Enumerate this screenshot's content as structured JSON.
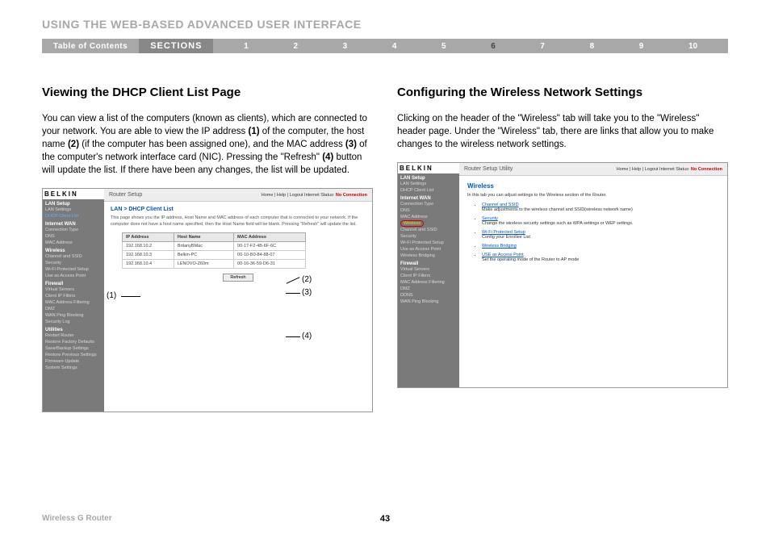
{
  "header": {
    "title": "USING THE WEB-BASED ADVANCED USER INTERFACE"
  },
  "nav": {
    "toc": "Table of Contents",
    "sections": "SECTIONS",
    "nums": [
      "1",
      "2",
      "3",
      "4",
      "5",
      "6",
      "7",
      "8",
      "9",
      "10"
    ],
    "active": "6"
  },
  "left": {
    "heading": "Viewing the DHCP Client List Page",
    "para": "You can view a list of the computers (known as clients), which are connected to your network. You are able to view the IP address (1) of the computer, the host name (2) (if the computer has been assigned one), and the MAC address (3) of the computer's network interface card (NIC). Pressing the \"Refresh\" (4) button will update the list. If there have been any changes, the list will be updated.",
    "ss": {
      "brand": "BELKIN",
      "setup": "Router Setup",
      "toplinks": "Home | Help | Logout   Internet Status:",
      "noconn": "No Connection",
      "crumb": "LAN > DHCP Client List",
      "desc": "This page shows you the IP address, Host Name and MAC address of each computer that is connected to your network. If the computer does not have a host name specified, then the Host Name field will be blank. Pressing \"Refresh\" will update the list.",
      "th": [
        "IP Address",
        "Host Name",
        "MAC Address"
      ],
      "rows": [
        [
          "192.168.10.2",
          "BritanyBMac",
          "00-17-F2-4B-6F-6C"
        ],
        [
          "192.168.10.3",
          "Belkin-PC",
          "00-10-B0-84-88-07"
        ],
        [
          "192.168.10.4",
          "LENOVO-Z60m",
          "00-16-36-59-D6-31"
        ]
      ],
      "refresh": "Refresh",
      "side": {
        "g1": "LAN Setup",
        "g1a": "LAN Settings",
        "g1b": "DHCP Client List",
        "g2": "Internet WAN",
        "g2a": "Connection Type",
        "g2b": "DNS",
        "g2c": "MAC Address",
        "g3": "Wireless",
        "g3a": "Channel and SSID",
        "g3b": "Security",
        "g3c": "Wi-Fi Protected Setup",
        "g3d": "Use as Access Point",
        "g4": "Firewall",
        "g4a": "Virtual Servers",
        "g4b": "Client IP Filters",
        "g4c": "MAC Address Filtering",
        "g4d": "DMZ",
        "g4e": "WAN Ping Blocking",
        "g4f": "Security Log",
        "g5": "Utilities",
        "g5a": "Restart Router",
        "g5b": "Restore Factory Defaults",
        "g5c": "Save/Backup Settings",
        "g5d": "Restore Previous Settings",
        "g5e": "Firmware Update",
        "g5f": "System Settings"
      }
    },
    "annots": {
      "a1": "(1)",
      "a2": "(2)",
      "a3": "(3)",
      "a4": "(4)"
    }
  },
  "right": {
    "heading": "Configuring the Wireless Network Settings",
    "para": "Clicking on the header of the \"Wireless\" tab will take you to the \"Wireless\" header page. Under the \"Wireless\" tab, there are links that allow you to make changes to the wireless network settings.",
    "ss": {
      "brand": "BELKIN",
      "setup": "Router Setup Utility",
      "toplinks": "Home | Help | Logout   Internet Status:",
      "noconn": "No Connection",
      "whead": "Wireless",
      "wdesc": "In this tab you can adjust settings to the Wireless section of the Router.",
      "items": [
        {
          "t": "Channel and SSID",
          "d": "Make adjustments to the wireless channel and SSID(wireless network name)"
        },
        {
          "t": "Security",
          "d": "Change the wireless security settings such as WPA settings or WEP settings."
        },
        {
          "t": "Wi-Fi Protected Setup",
          "d": "Config your Enrollee List"
        },
        {
          "t": "Wireless Bridging",
          "d": ""
        },
        {
          "t": "USE as Access Point",
          "d": "Set the operating mode of the Router to AP mode"
        }
      ],
      "side": {
        "g1": "LAN Setup",
        "g1a": "LAN Settings",
        "g1b": "DHCP Client List",
        "g2": "Internet WAN",
        "g2a": "Connection Type",
        "g2b": "DNS",
        "g2c": "MAC Address",
        "g3": "Wireless",
        "g3a": "Channel and SSID",
        "g3b": "Security",
        "g3c": "Wi-Fi Protected Setup",
        "g3d": "Use as Access Point",
        "g3e": "Wireless Bridging",
        "g4": "Firewall",
        "g4a": "Virtual Servers",
        "g4b": "Client IP Filters",
        "g4c": "MAC Address Filtering",
        "g4d": "DMZ",
        "g4e": "DDNS",
        "g4f": "WAN Ping Blocking"
      }
    }
  },
  "footer": {
    "product": "Wireless G Router",
    "page": "43"
  }
}
